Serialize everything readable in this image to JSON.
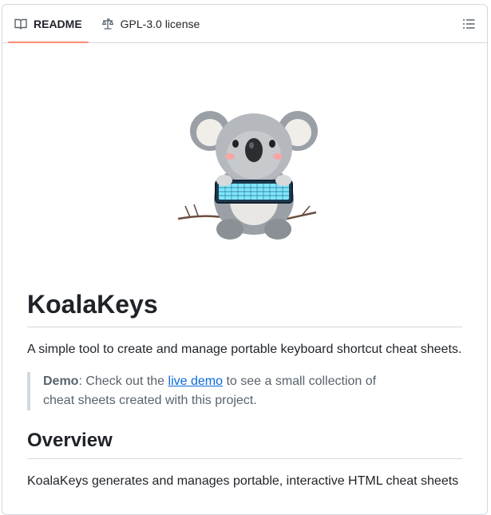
{
  "tabs": [
    {
      "label": "README",
      "icon": "book-icon",
      "active": true
    },
    {
      "label": "GPL-3.0 license",
      "icon": "law-scale-icon",
      "active": false
    }
  ],
  "outline_icon": "list-unordered-icon",
  "hero_image": "koala-typing-keyboard-illustration",
  "readme": {
    "title": "KoalaKeys",
    "description": "A simple tool to create and manage portable keyboard shortcut cheat sheets.",
    "quote": {
      "label": "Demo",
      "before": ": Check out the ",
      "link": "live demo",
      "after": " to see a small collection of cheat sheets created with this project."
    },
    "section_heading": "Overview",
    "section_text": "KoalaKeys generates and manages portable, interactive HTML cheat sheets"
  },
  "colors": {
    "accent": "#fd8c73",
    "link": "#0969da",
    "border": "#d1d9e0"
  }
}
